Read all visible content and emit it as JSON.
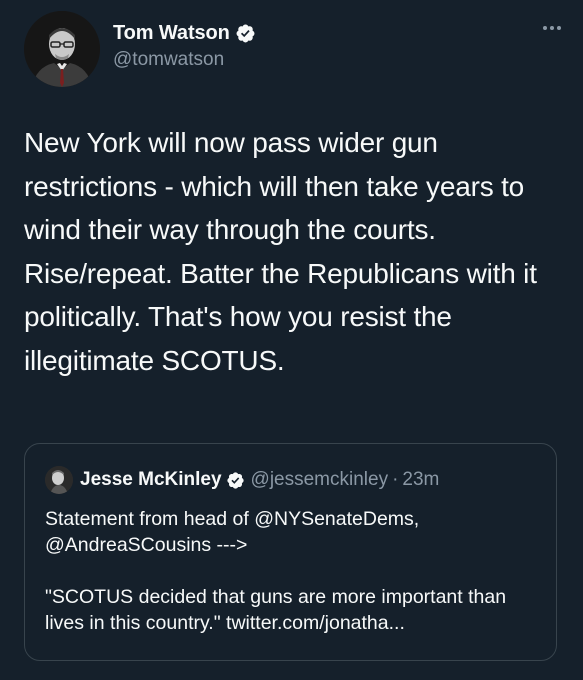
{
  "author": {
    "name": "Tom Watson",
    "handle": "@tomwatson",
    "verified_icon": "verified-badge-icon",
    "avatar_alt": "Tom Watson profile photo"
  },
  "tweet": {
    "text": "New York will now pass wider gun restrictions - which will then take years to wind their way through the courts. Rise/repeat. Batter the Republicans with it politically. That's how you resist the illegitimate SCOTUS."
  },
  "more_menu_icon": "more-horizontal-icon",
  "quoted_tweet": {
    "name": "Jesse McKinley",
    "handle": "@jessemckinley",
    "separator": "·",
    "time": "23m",
    "paragraphs": [
      "Statement from head of @NYSenateDems, @AndreaSCousins --->",
      "\"SCOTUS decided that guns are more important than lives in this country.\" twitter.com/jonatha..."
    ]
  },
  "colors": {
    "background": "#15202b",
    "text_primary": "#f7f9f9",
    "text_secondary": "#8b98a5",
    "border": "#38444d",
    "verified": "#f7f9f9"
  }
}
